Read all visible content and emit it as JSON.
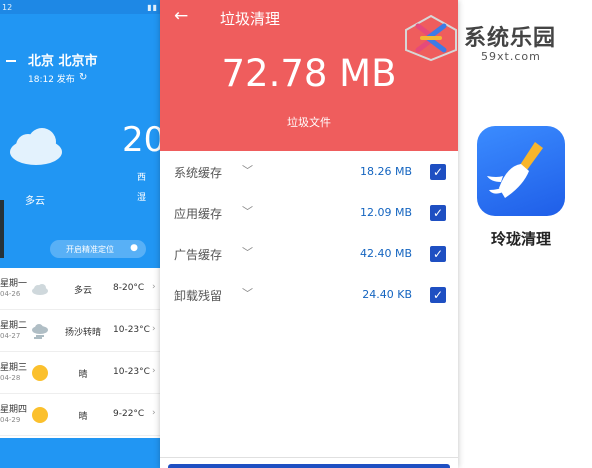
{
  "weather": {
    "status_time": "12",
    "city": "北京 北京市",
    "updated": "18:12 发布",
    "temperature": "20",
    "condition": "多云",
    "mini_1": "西",
    "mini_2": "湿",
    "locate_button": "开启精准定位",
    "forecast": [
      {
        "day": "星期一",
        "date": "04-26",
        "icon": "cloud-icon",
        "cond": "多云",
        "range": "8-20°C"
      },
      {
        "day": "星期二",
        "date": "04-27",
        "icon": "sandstorm-icon",
        "cond": "扬沙转晴",
        "range": "10-23°C"
      },
      {
        "day": "星期三",
        "date": "04-28",
        "icon": "sun-icon",
        "cond": "晴",
        "range": "10-23°C"
      },
      {
        "day": "星期四",
        "date": "04-29",
        "icon": "sun-icon",
        "cond": "晴",
        "range": "9-22°C"
      }
    ]
  },
  "cleaner": {
    "title": "垃圾清理",
    "total_size": "72.78 MB",
    "subtitle": "垃圾文件",
    "header_color": "#ef5d5d",
    "accent_color": "#1e4fc2",
    "items": [
      {
        "label": "系统缓存",
        "size": "18.26 MB",
        "checked": true
      },
      {
        "label": "应用缓存",
        "size": "12.09 MB",
        "checked": true
      },
      {
        "label": "广告缓存",
        "size": "42.40 MB",
        "checked": true
      },
      {
        "label": "卸载残留",
        "size": "24.40 KB",
        "checked": true
      }
    ]
  },
  "watermark": {
    "name": "系统乐园",
    "url": "59xt.com"
  },
  "app": {
    "name": "玲珑清理",
    "icon": "broom-icon"
  }
}
